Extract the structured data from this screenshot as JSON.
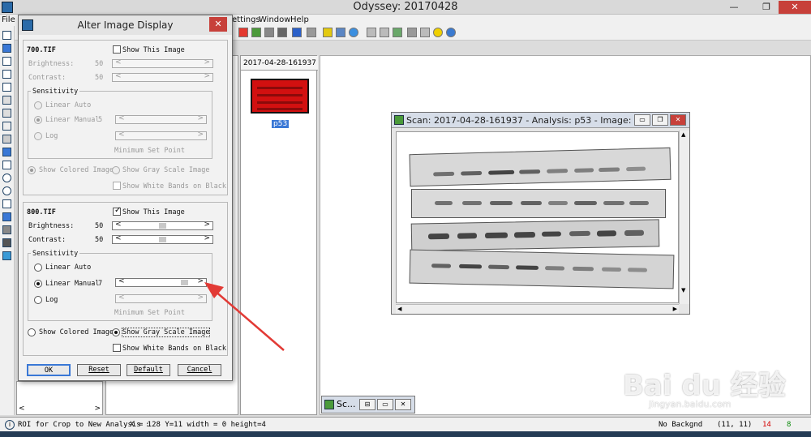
{
  "app": {
    "title": "Odyssey: 20170428",
    "minimize": "—",
    "restore": "❐",
    "close": "✕"
  },
  "menu": {
    "file": "File",
    "settings": "ettings",
    "window": "Window",
    "help": "Help"
  },
  "thumbnail_panel": {
    "tab": "2017-04-28-161937 ...",
    "item_label": "p53"
  },
  "scan_window": {
    "title": "Scan: 2017-04-28-161937 - Analysis: p53 - Image: ...",
    "minimize": "▭",
    "restore": "❐",
    "close": "✕",
    "scroll_up": "▲",
    "scroll_down": "▼",
    "scroll_left": "◀",
    "scroll_right": "▶"
  },
  "mini_window": {
    "label": "Sc...",
    "minimize": "⊟",
    "restore": "▭",
    "close": "✕"
  },
  "dialog": {
    "title": "Alter Image Display",
    "close": "✕",
    "ch700": {
      "name": "700.TIF",
      "show_image": "Show This Image",
      "show_image_checked": false,
      "brightness_label": "Brightness:",
      "brightness_value": "50",
      "contrast_label": "Contrast:",
      "contrast_value": "50",
      "sensitivity": "Sensitivity",
      "linear_auto": "Linear Auto",
      "linear_manual": "Linear Manual",
      "linear_manual_value": "5",
      "log": "Log",
      "min_set_point": "Minimum Set Point",
      "show_colored": "Show Colored Image",
      "show_gray": "Show Gray Scale Image",
      "show_white_bands": "Show White Bands on Black",
      "sensitivity_mode": "Linear Manual",
      "display_mode": "Show Colored Image"
    },
    "ch800": {
      "name": "800.TIF",
      "show_image": "Show This Image",
      "show_image_checked": true,
      "brightness_label": "Brightness:",
      "brightness_value": "50",
      "contrast_label": "Contrast:",
      "contrast_value": "50",
      "sensitivity": "Sensitivity",
      "linear_auto": "Linear Auto",
      "linear_manual": "Linear Manual",
      "linear_manual_value": "7",
      "log": "Log",
      "min_set_point": "Minimum Set Point",
      "show_colored": "Show Colored Image",
      "show_gray": "Show Gray Scale Image",
      "show_white_bands": "Show White Bands on Black",
      "sensitivity_mode": "Linear Manual",
      "display_mode": "Show Gray Scale Image"
    },
    "buttons": {
      "ok": "OK",
      "reset": "Reset",
      "default": "Default",
      "cancel": "Cancel"
    },
    "arrow_left": "<",
    "arrow_right": ">"
  },
  "statusbar": {
    "message": "ROI for Crop to New Analysis :",
    "coords": "X = 128 Y=11 width = 0 height=4",
    "backgnd": "No Backgnd",
    "cursor": "(11, 11)",
    "value_red": "14",
    "value_green": "8"
  },
  "watermark": {
    "brand": "Bai du 经验",
    "url": "jingyan.baidu.com"
  },
  "colors": {
    "accent_red": "#e23a35",
    "status_red": "#d40000",
    "status_green": "#0a8a0a",
    "selection_blue": "#3a78d6"
  }
}
